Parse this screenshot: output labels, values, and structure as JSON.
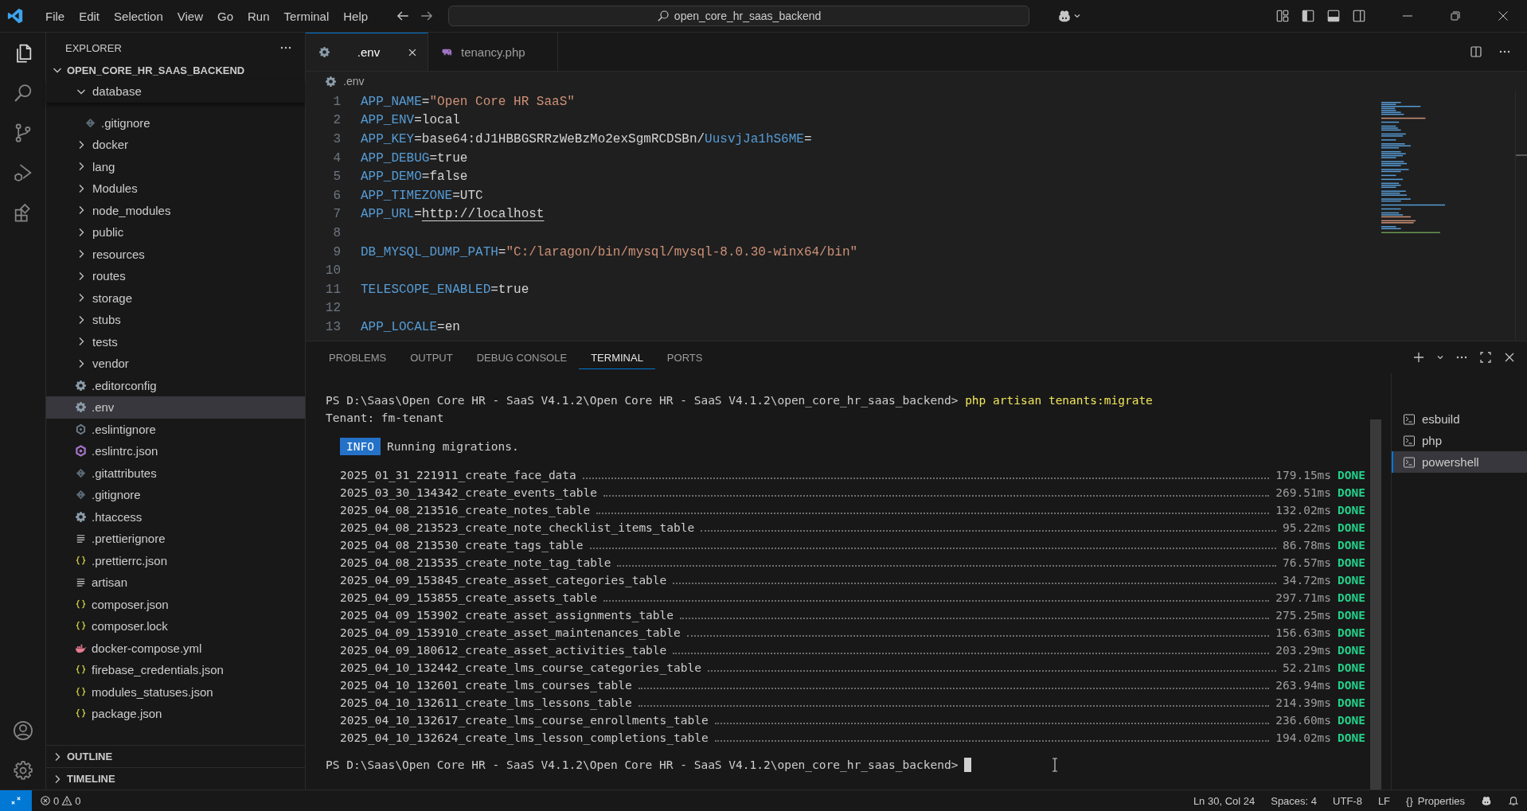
{
  "menu": [
    "File",
    "Edit",
    "Selection",
    "View",
    "Go",
    "Run",
    "Terminal",
    "Help"
  ],
  "search": {
    "value": "open_core_hr_saas_backend"
  },
  "explorer": {
    "title": "EXPLORER",
    "root": {
      "label": "OPEN_CORE_HR_SAAS_BACKEND",
      "expanded": true
    },
    "items": [
      {
        "label": "database",
        "kind": "folder",
        "expanded": true,
        "selected": false,
        "children": [
          {
            "label": ".gitignore",
            "kind": "git",
            "selected": false
          }
        ]
      },
      {
        "label": "docker",
        "kind": "folder",
        "expanded": false,
        "selected": false
      },
      {
        "label": "lang",
        "kind": "folder",
        "expanded": false,
        "selected": false
      },
      {
        "label": "Modules",
        "kind": "folder",
        "expanded": false,
        "selected": false
      },
      {
        "label": "node_modules",
        "kind": "folder",
        "expanded": false,
        "selected": false
      },
      {
        "label": "public",
        "kind": "folder",
        "expanded": false,
        "selected": false
      },
      {
        "label": "resources",
        "kind": "folder",
        "expanded": false,
        "selected": false
      },
      {
        "label": "routes",
        "kind": "folder",
        "expanded": false,
        "selected": false
      },
      {
        "label": "storage",
        "kind": "folder",
        "expanded": false,
        "selected": false
      },
      {
        "label": "stubs",
        "kind": "folder",
        "expanded": false,
        "selected": false
      },
      {
        "label": "tests",
        "kind": "folder",
        "expanded": false,
        "selected": false
      },
      {
        "label": "vendor",
        "kind": "folder",
        "expanded": false,
        "selected": false
      },
      {
        "label": ".editorconfig",
        "kind": "gear",
        "selected": false
      },
      {
        "label": ".env",
        "kind": "gear",
        "selected": true
      },
      {
        "label": ".eslintignore",
        "kind": "hex",
        "selected": false
      },
      {
        "label": ".eslintrc.json",
        "kind": "eslint",
        "selected": false
      },
      {
        "label": ".gitattributes",
        "kind": "git",
        "selected": false
      },
      {
        "label": ".gitignore",
        "kind": "git",
        "selected": false
      },
      {
        "label": ".htaccess",
        "kind": "gear",
        "selected": false
      },
      {
        "label": ".prettierignore",
        "kind": "lines",
        "selected": false
      },
      {
        "label": ".prettierrc.json",
        "kind": "json",
        "selected": false
      },
      {
        "label": "artisan",
        "kind": "lines",
        "selected": false
      },
      {
        "label": "composer.json",
        "kind": "json",
        "selected": false
      },
      {
        "label": "composer.lock",
        "kind": "json",
        "selected": false
      },
      {
        "label": "docker-compose.yml",
        "kind": "docker",
        "selected": false
      },
      {
        "label": "firebase_credentials.json",
        "kind": "json",
        "selected": false
      },
      {
        "label": "modules_statuses.json",
        "kind": "json",
        "selected": false
      },
      {
        "label": "package.json",
        "kind": "json",
        "selected": false
      }
    ],
    "sections": [
      {
        "label": "OUTLINE",
        "expanded": false
      },
      {
        "label": "TIMELINE",
        "expanded": false
      }
    ]
  },
  "editor": {
    "tabs": [
      {
        "label": ".env",
        "kind": "gear",
        "selected": true
      },
      {
        "label": "tenancy.php",
        "kind": "php",
        "selected": false
      }
    ],
    "breadcrumb": ".env",
    "lines": [
      {
        "number": "1",
        "tokens": [
          {
            "text": "APP_NAME",
            "kind": "key"
          },
          {
            "text": "=",
            "kind": "op"
          },
          {
            "text": "\"Open Core HR SaaS\"",
            "kind": "str"
          }
        ]
      },
      {
        "number": "2",
        "tokens": [
          {
            "text": "APP_ENV",
            "kind": "key"
          },
          {
            "text": "=",
            "kind": "op"
          },
          {
            "text": "local",
            "kind": "val"
          }
        ]
      },
      {
        "number": "3",
        "tokens": [
          {
            "text": "APP_KEY",
            "kind": "key"
          },
          {
            "text": "=",
            "kind": "op"
          },
          {
            "text": "base64:dJ1HBBGSRRzWeBzMo2exSgmRCDSBn/",
            "kind": "val"
          },
          {
            "text": "UusvjJa1hS6ME",
            "kind": "key"
          },
          {
            "text": "=",
            "kind": "op"
          }
        ]
      },
      {
        "number": "4",
        "tokens": [
          {
            "text": "APP_DEBUG",
            "kind": "key"
          },
          {
            "text": "=",
            "kind": "op"
          },
          {
            "text": "true",
            "kind": "val"
          }
        ]
      },
      {
        "number": "5",
        "tokens": [
          {
            "text": "APP_DEMO",
            "kind": "key"
          },
          {
            "text": "=",
            "kind": "op"
          },
          {
            "text": "false",
            "kind": "val"
          }
        ]
      },
      {
        "number": "6",
        "tokens": [
          {
            "text": "APP_TIMEZONE",
            "kind": "key"
          },
          {
            "text": "=",
            "kind": "op"
          },
          {
            "text": "UTC",
            "kind": "val"
          }
        ]
      },
      {
        "number": "7",
        "tokens": [
          {
            "text": "APP_URL",
            "kind": "key"
          },
          {
            "text": "=",
            "kind": "op"
          },
          {
            "text": "http://localhost",
            "kind": "link"
          }
        ]
      },
      {
        "number": "8"
      },
      {
        "number": "9",
        "tokens": [
          {
            "text": "DB_MYSQL_DUMP_PATH",
            "kind": "key"
          },
          {
            "text": "=",
            "kind": "op"
          },
          {
            "text": "\"C:/laragon/bin/mysql/mysql-8.0.30-winx64/bin\"",
            "kind": "str"
          }
        ]
      },
      {
        "number": "10"
      },
      {
        "number": "11",
        "tokens": [
          {
            "text": "TELESCOPE_ENABLED",
            "kind": "key"
          },
          {
            "text": "=",
            "kind": "op"
          },
          {
            "text": "true",
            "kind": "val"
          }
        ]
      },
      {
        "number": "12"
      },
      {
        "number": "13",
        "tokens": [
          {
            "text": "APP_LOCALE",
            "kind": "key"
          },
          {
            "text": "=",
            "kind": "op"
          },
          {
            "text": "en",
            "kind": "val"
          }
        ]
      }
    ]
  },
  "panel": {
    "tabs": [
      {
        "label": "PROBLEMS",
        "selected": false
      },
      {
        "label": "OUTPUT",
        "selected": false
      },
      {
        "label": "DEBUG CONSOLE",
        "selected": false
      },
      {
        "label": "TERMINAL",
        "selected": true
      },
      {
        "label": "PORTS",
        "selected": false
      }
    ],
    "terminal": {
      "prompt": "PS D:\\Saas\\Open Core HR - SaaS V4.1.2\\Open Core HR - SaaS V4.1.2\\open_core_hr_saas_backend>",
      "command": "php artisan tenants:migrate",
      "tenant": "Tenant: fm-tenant",
      "info_badge": "INFO",
      "info_text": "Running migrations.",
      "migrations": [
        {
          "name": "2025_01_31_221911_create_face_data",
          "time": "179.15ms",
          "status": "DONE"
        },
        {
          "name": "2025_03_30_134342_create_events_table",
          "time": "269.51ms",
          "status": "DONE"
        },
        {
          "name": "2025_04_08_213516_create_notes_table",
          "time": "132.02ms",
          "status": "DONE"
        },
        {
          "name": "2025_04_08_213523_create_note_checklist_items_table",
          "time": "95.22ms",
          "status": "DONE"
        },
        {
          "name": "2025_04_08_213530_create_tags_table",
          "time": "86.78ms",
          "status": "DONE"
        },
        {
          "name": "2025_04_08_213535_create_note_tag_table",
          "time": "76.57ms",
          "status": "DONE"
        },
        {
          "name": "2025_04_09_153845_create_asset_categories_table",
          "time": "34.72ms",
          "status": "DONE"
        },
        {
          "name": "2025_04_09_153855_create_assets_table",
          "time": "297.71ms",
          "status": "DONE"
        },
        {
          "name": "2025_04_09_153902_create_asset_assignments_table",
          "time": "275.25ms",
          "status": "DONE"
        },
        {
          "name": "2025_04_09_153910_create_asset_maintenances_table",
          "time": "156.63ms",
          "status": "DONE"
        },
        {
          "name": "2025_04_09_180612_create_asset_activities_table",
          "time": "203.29ms",
          "status": "DONE"
        },
        {
          "name": "2025_04_10_132442_create_lms_course_categories_table",
          "time": "52.21ms",
          "status": "DONE"
        },
        {
          "name": "2025_04_10_132601_create_lms_courses_table",
          "time": "263.94ms",
          "status": "DONE"
        },
        {
          "name": "2025_04_10_132611_create_lms_lessons_table",
          "time": "214.39ms",
          "status": "DONE"
        },
        {
          "name": "2025_04_10_132617_create_lms_course_enrollments_table",
          "time": "236.60ms",
          "status": "DONE"
        },
        {
          "name": "2025_04_10_132624_create_lms_lesson_completions_table",
          "time": "194.02ms",
          "status": "DONE"
        }
      ],
      "final_prompt": "PS D:\\Saas\\Open Core HR - SaaS V4.1.2\\Open Core HR - SaaS V4.1.2\\open_core_hr_saas_backend>"
    },
    "terminals": [
      {
        "label": "esbuild",
        "selected": false
      },
      {
        "label": "php",
        "selected": false
      },
      {
        "label": "powershell",
        "selected": true
      }
    ]
  },
  "status_bar": {
    "errors": "0",
    "warnings": "0",
    "position": "Ln 30, Col 24",
    "spaces": "Spaces: 4",
    "encoding": "UTF-8",
    "eol": "LF",
    "language_icon": "{}",
    "language": "Properties"
  }
}
